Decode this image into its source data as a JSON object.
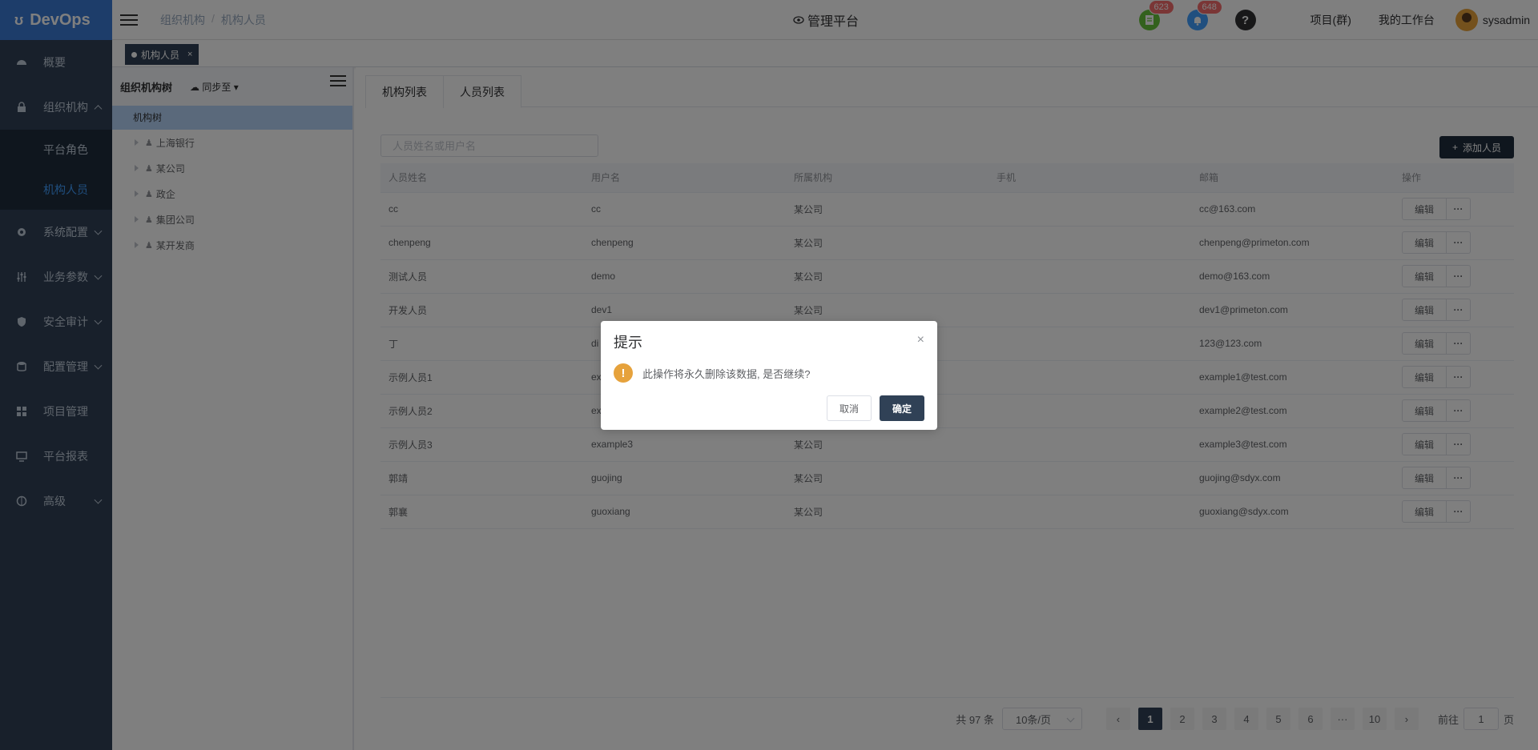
{
  "app": {
    "logo_text": "DevOps",
    "platform_title": "管理平台"
  },
  "breadcrumb": {
    "items": [
      "组织机构",
      "机构人员"
    ],
    "separator": "/"
  },
  "header": {
    "badge_doc": "623",
    "badge_bell": "648",
    "help_glyph": "?",
    "project_link": "项目(群)",
    "workspace_link": "我的工作台",
    "username": "sysadmin"
  },
  "sidebar": {
    "items": [
      {
        "label": "概要"
      },
      {
        "label": "组织机构"
      },
      {
        "label": "系统配置"
      },
      {
        "label": "业务参数"
      },
      {
        "label": "安全审计"
      },
      {
        "label": "配置管理"
      },
      {
        "label": "项目管理"
      },
      {
        "label": "平台报表"
      },
      {
        "label": "高级"
      }
    ],
    "sub_items": [
      {
        "label": "平台角色"
      },
      {
        "label": "机构人员"
      }
    ]
  },
  "tags": {
    "active": "机构人员",
    "close": "×"
  },
  "tree": {
    "title": "组织机构树",
    "sync_label": "同步至",
    "root": "机构树",
    "nodes": [
      "上海银行",
      "某公司",
      "政企",
      "集团公司",
      "某开发商"
    ]
  },
  "tabs": {
    "org_list": "机构列表",
    "user_list": "人员列表"
  },
  "search": {
    "placeholder": "人员姓名或用户名"
  },
  "add_button": "添加人员",
  "table": {
    "headers": [
      "人员姓名",
      "用户名",
      "所属机构",
      "手机",
      "邮箱",
      "操作"
    ],
    "rows": [
      {
        "name": "cc",
        "username": "cc",
        "org": "某公司",
        "phone": "",
        "email": "cc@163.com"
      },
      {
        "name": "chenpeng",
        "username": "chenpeng",
        "org": "某公司",
        "phone": "",
        "email": "chenpeng@primeton.com"
      },
      {
        "name": "测试人员",
        "username": "demo",
        "org": "某公司",
        "phone": "",
        "email": "demo@163.com"
      },
      {
        "name": "开发人员",
        "username": "dev1",
        "org": "某公司",
        "phone": "",
        "email": "dev1@primeton.com"
      },
      {
        "name": "丁",
        "username": "di",
        "org": "",
        "phone": "",
        "email": "123@123.com"
      },
      {
        "name": "示例人员1",
        "username": "ex",
        "org": "",
        "phone": "",
        "email": "example1@test.com"
      },
      {
        "name": "示例人员2",
        "username": "ex",
        "org": "",
        "phone": "",
        "email": "example2@test.com"
      },
      {
        "name": "示例人员3",
        "username": "example3",
        "org": "某公司",
        "phone": "",
        "email": "example3@test.com"
      },
      {
        "name": "郭靖",
        "username": "guojing",
        "org": "某公司",
        "phone": "",
        "email": "guojing@sdyx.com"
      },
      {
        "name": "郭襄",
        "username": "guoxiang",
        "org": "某公司",
        "phone": "",
        "email": "guoxiang@sdyx.com"
      }
    ],
    "edit_label": "编辑",
    "more_label": "···"
  },
  "pagination": {
    "total": "共 97 条",
    "page_size": "10条/页",
    "pages": [
      "1",
      "2",
      "3",
      "4",
      "5",
      "6",
      "···",
      "10"
    ],
    "current": "1",
    "prev": "‹",
    "next": "›",
    "goto_label": "前往",
    "goto_value": "1",
    "page_suffix": "页"
  },
  "dialog": {
    "title": "提示",
    "close": "×",
    "icon": "!",
    "message": "此操作将永久删除该数据, 是否继续?",
    "cancel": "取消",
    "confirm": "确定"
  },
  "colors": {
    "sidebar": "#304156",
    "logo": "#3a7bd5",
    "accent": "#409eff",
    "warning": "#e6a23c",
    "badge": "#f56c6c"
  }
}
